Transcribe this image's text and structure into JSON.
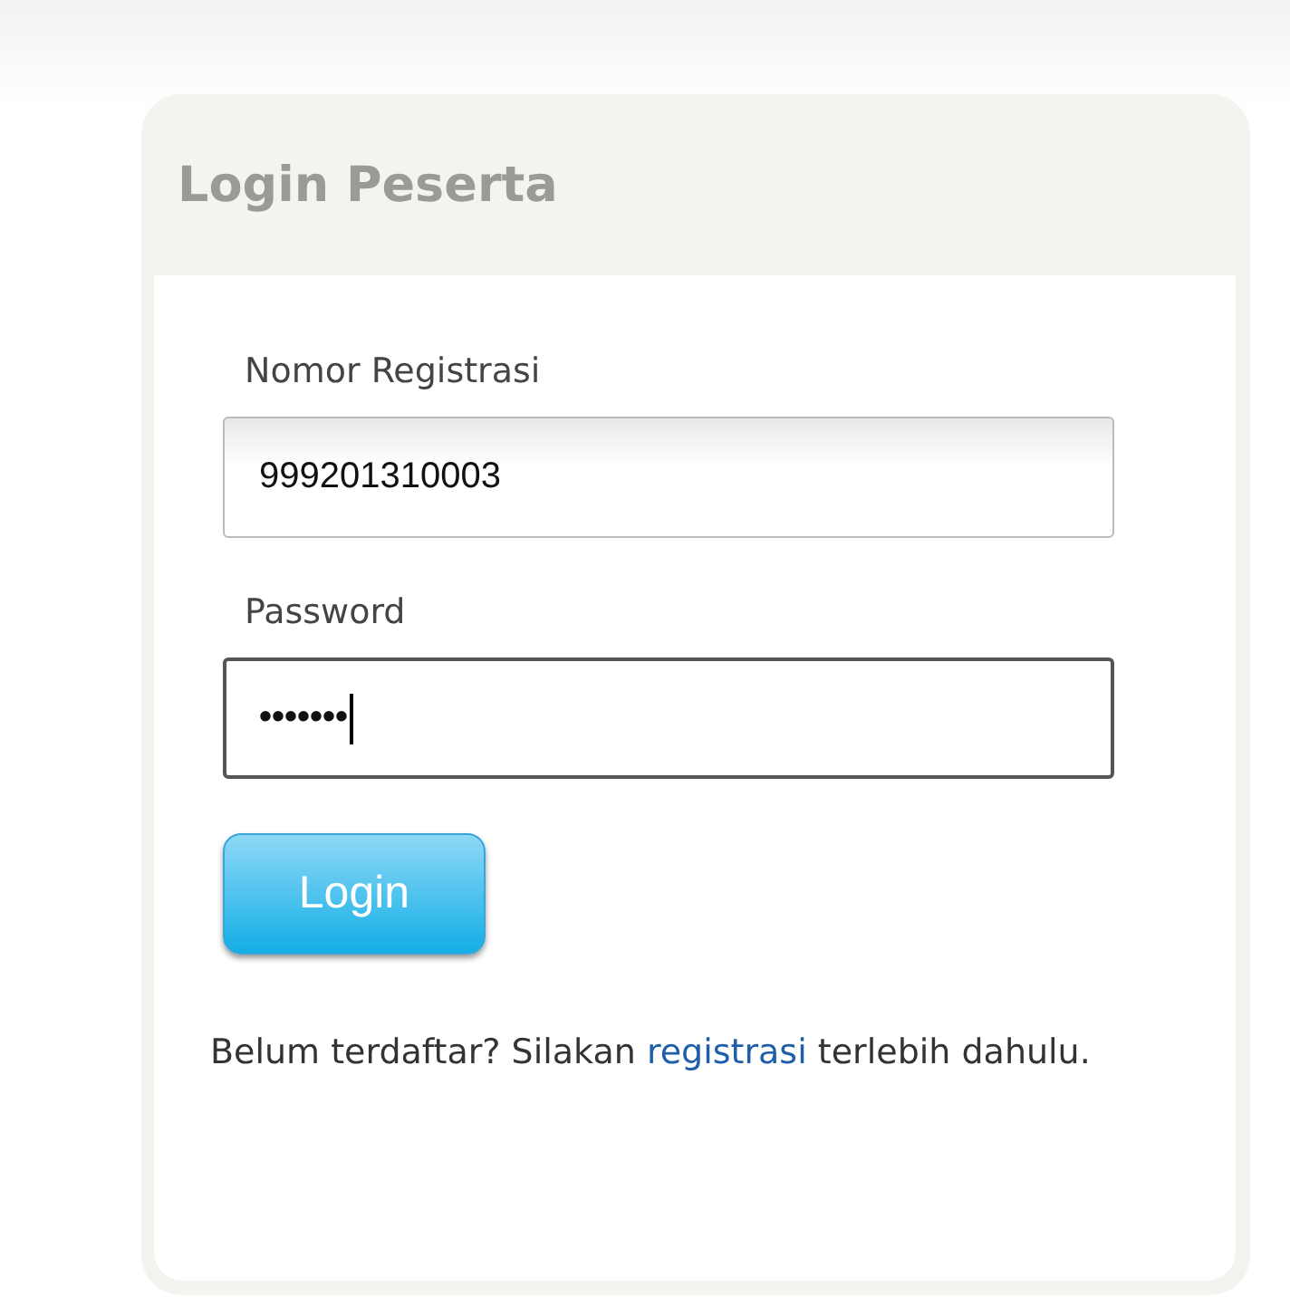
{
  "panel": {
    "title": "Login Peserta"
  },
  "fields": [
    {
      "label": "Nomor Registrasi",
      "value": "999201310003",
      "focused": false
    },
    {
      "label": "Password",
      "value": "•••••••",
      "focused": true
    }
  ],
  "button": "Login",
  "note": {
    "before": "Belum terdaftar? Silakan",
    "link": "registrasi",
    "after": "terlebih dahulu."
  }
}
